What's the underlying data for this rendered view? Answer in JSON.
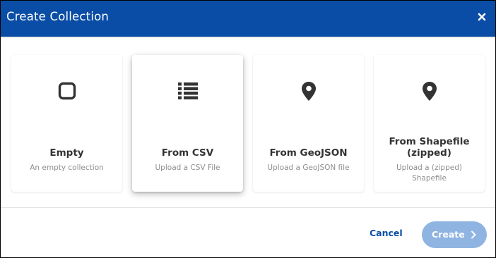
{
  "dialog": {
    "title": "Create Collection",
    "close_icon": "close-icon"
  },
  "options": [
    {
      "title": "Empty",
      "description": "An empty collection",
      "icon": "square-outline-icon",
      "selected": false
    },
    {
      "title": "From CSV",
      "description": "Upload a CSV File",
      "icon": "list-icon",
      "selected": true
    },
    {
      "title": "From GeoJSON",
      "description": "Upload a GeoJSON file",
      "icon": "map-marker-icon",
      "selected": false
    },
    {
      "title": "From Shapefile (zipped)",
      "description": "Upload a (zipped) Shapefile",
      "icon": "map-marker-icon",
      "selected": false
    }
  ],
  "footer": {
    "cancel_label": "Cancel",
    "create_label": "Create",
    "create_icon": "chevron-right-icon"
  },
  "colors": {
    "header_bg": "#0a4da6",
    "accent": "#0a4da6",
    "create_button_disabled": "#8fb4e2",
    "icon": "#333333"
  }
}
